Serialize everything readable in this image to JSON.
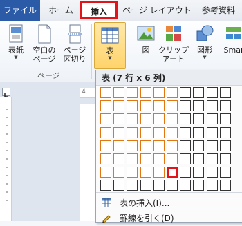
{
  "tabs": {
    "file": "ファイル",
    "home": "ホーム",
    "insert": "挿入",
    "layout": "ページ レイアウト",
    "references": "参考資料"
  },
  "ribbon": {
    "cover": {
      "line1": "表紙"
    },
    "blank": {
      "line1": "空白の",
      "line2": "ページ"
    },
    "break": {
      "line1": "ページ",
      "line2": "区切り"
    },
    "pages_group": "ページ",
    "table": {
      "line1": "表"
    },
    "picture": {
      "line1": "図"
    },
    "clipart": {
      "line1": "クリップ",
      "line2": "アート"
    },
    "shapes": {
      "line1": "図形"
    },
    "smartart": {
      "line1": "Smar"
    }
  },
  "ruler": {
    "number": "4"
  },
  "dropdown": {
    "header": "表 (7 行 x 6 列)",
    "grid": {
      "cols": 10,
      "rows": 8,
      "selected_cols": 6,
      "selected_rows": 7
    },
    "items": [
      {
        "label": "表の挿入(I)..."
      },
      {
        "label": "罫線を引く(D)"
      }
    ]
  },
  "colors": {
    "accent_red": "#e3131a",
    "selection_orange": "#e2760f",
    "file_tab_blue": "#2b5aa6"
  }
}
